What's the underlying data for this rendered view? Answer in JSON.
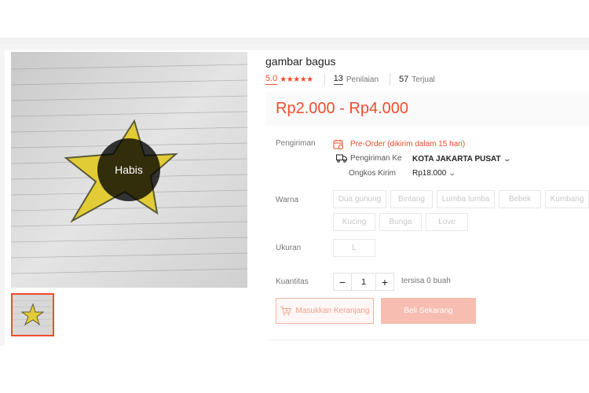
{
  "product": {
    "title": "gambar bagus",
    "rating": "5.0",
    "stars": "★★★★★",
    "reviews_count": "13",
    "reviews_label": "Penilaian",
    "sold_count": "57",
    "sold_label": "Terjual",
    "price": "Rp2.000 - Rp4.000",
    "sold_out_badge": "Habis"
  },
  "shipping": {
    "label": "Pengiriman",
    "preorder": "Pre-Order (dikirim dalam 15 hari)",
    "to_label": "Pengiriman Ke",
    "to_value": "KOTA JAKARTA PUSAT",
    "cost_label": "Ongkos Kirim",
    "cost_value": "Rp18.000"
  },
  "variants": {
    "color_label": "Warna",
    "colors": [
      "Dua gunung",
      "Bintang",
      "Lumba lumba",
      "Bebek",
      "Kumbang",
      "Kucing",
      "Bunga",
      "Love"
    ],
    "size_label": "Ukuran",
    "sizes": [
      "L"
    ]
  },
  "quantity": {
    "label": "Kuantitas",
    "minus": "−",
    "value": "1",
    "plus": "+",
    "stock": "tersisa 0 buah"
  },
  "actions": {
    "add_to_cart": "Masukkan Keranjang",
    "buy_now": "Beli Sekarang"
  },
  "colors": {
    "accent": "#ee4d2d",
    "disabled_buy": "#f6bdb0"
  },
  "icons": {
    "preorder": "calendar-icon",
    "shipping": "truck-icon",
    "cart": "cart-plus-icon"
  }
}
